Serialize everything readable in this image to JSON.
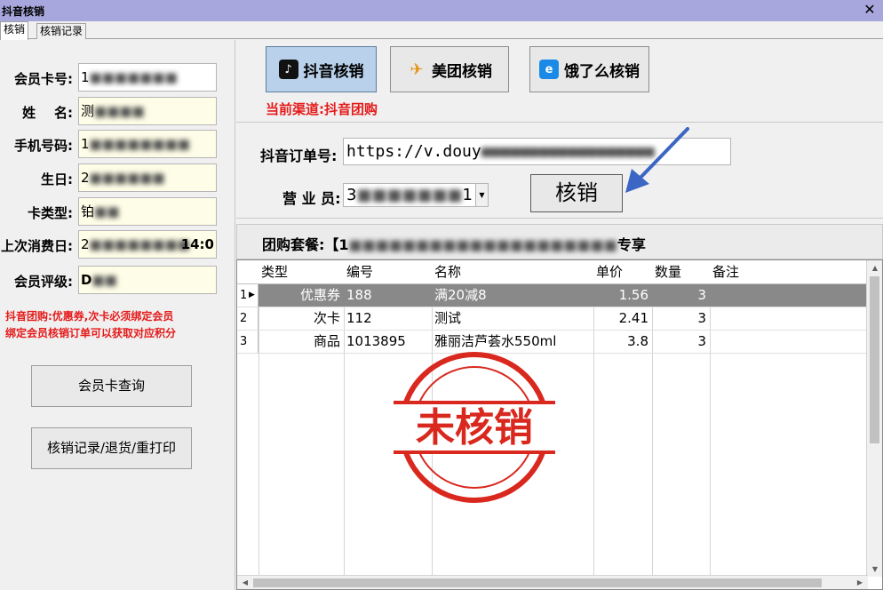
{
  "window": {
    "title": "抖音核销",
    "close": "✕"
  },
  "tabs": [
    {
      "label": "核销"
    },
    {
      "label": "核销记录"
    }
  ],
  "member": {
    "card_no": {
      "label": "会员卡号:",
      "value": "1"
    },
    "name": {
      "label": "姓    名:",
      "value": "测"
    },
    "phone": {
      "label": "手机号码:",
      "value": "1"
    },
    "birthday": {
      "label": "生日:",
      "value": "2"
    },
    "card_type": {
      "label": "卡类型:",
      "value": "铂"
    },
    "last_visit": {
      "label": "上次消费日:",
      "value": "2",
      "time": "14:0"
    },
    "level": {
      "label": "会员评级:",
      "value": "D"
    }
  },
  "note": "抖音团购:优惠券,次卡必须绑定会员\n绑定会员核销订单可以获取对应积分",
  "buttons": {
    "card_query": "会员卡查询",
    "records": "核销记录/退货/重打印",
    "verify": "核销"
  },
  "channels": [
    {
      "label": "抖音核销",
      "icon": "douyin-icon"
    },
    {
      "label": "美团核销",
      "icon": "meituan-icon"
    },
    {
      "label": "饿了么核销",
      "icon": "eleme-icon"
    }
  ],
  "current_channel": "当前渠道:抖音团购",
  "order": {
    "label": "抖音订单号:",
    "value": "https://v.douy"
  },
  "clerk": {
    "label": "营 业 员:",
    "value": "3",
    "value_tail": "1"
  },
  "package": {
    "label": "团购套餐:【1",
    "tail": "专享"
  },
  "grid": {
    "columns": [
      "类型",
      "编号",
      "名称",
      "单价",
      "数量",
      "备注"
    ],
    "rows": [
      {
        "num": "1",
        "type": "优惠券",
        "code": "188",
        "name": "满20减8",
        "price": "1.56",
        "qty": "3",
        "note": ""
      },
      {
        "num": "2",
        "type": "次卡",
        "code": "112",
        "name": "测试",
        "price": "2.41",
        "qty": "3",
        "note": ""
      },
      {
        "num": "3",
        "type": "商品",
        "code": "1013895",
        "name": "雅丽洁芦荟水550ml",
        "price": "3.8",
        "qty": "3",
        "note": ""
      }
    ]
  },
  "stamp": {
    "text": "未核销",
    "color": "#d9281e"
  },
  "colors": {
    "title_bar": "#a8a7dd",
    "accent_red": "#e51a1a",
    "field_bg": "#fefde7",
    "selected_row": "#898989"
  }
}
